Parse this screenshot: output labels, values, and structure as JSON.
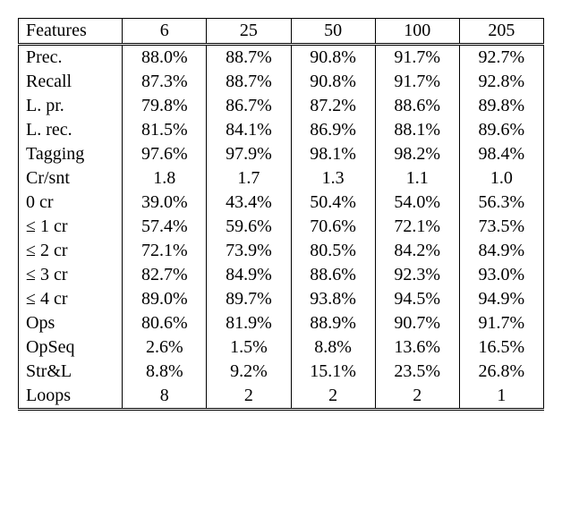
{
  "chart_data": {
    "type": "table",
    "title": "",
    "columns": [
      "Features",
      "6",
      "25",
      "50",
      "100",
      "205"
    ],
    "rows": [
      {
        "label": "Prec.",
        "values": [
          "88.0%",
          "88.7%",
          "90.8%",
          "91.7%",
          "92.7%"
        ]
      },
      {
        "label": "Recall",
        "values": [
          "87.3%",
          "88.7%",
          "90.8%",
          "91.7%",
          "92.8%"
        ]
      },
      {
        "label": "L. pr.",
        "values": [
          "79.8%",
          "86.7%",
          "87.2%",
          "88.6%",
          "89.8%"
        ]
      },
      {
        "label": "L. rec.",
        "values": [
          "81.5%",
          "84.1%",
          "86.9%",
          "88.1%",
          "89.6%"
        ]
      },
      {
        "label": "Tagging",
        "values": [
          "97.6%",
          "97.9%",
          "98.1%",
          "98.2%",
          "98.4%"
        ]
      },
      {
        "label": "Cr/snt",
        "values": [
          "1.8",
          "1.7",
          "1.3",
          "1.1",
          "1.0"
        ]
      },
      {
        "label": "0 cr",
        "values": [
          "39.0%",
          "43.4%",
          "50.4%",
          "54.0%",
          "56.3%"
        ]
      },
      {
        "label": "≤ 1 cr",
        "values": [
          "57.4%",
          "59.6%",
          "70.6%",
          "72.1%",
          "73.5%"
        ]
      },
      {
        "label": "≤ 2 cr",
        "values": [
          "72.1%",
          "73.9%",
          "80.5%",
          "84.2%",
          "84.9%"
        ]
      },
      {
        "label": "≤ 3 cr",
        "values": [
          "82.7%",
          "84.9%",
          "88.6%",
          "92.3%",
          "93.0%"
        ]
      },
      {
        "label": "≤ 4 cr",
        "values": [
          "89.0%",
          "89.7%",
          "93.8%",
          "94.5%",
          "94.9%"
        ]
      },
      {
        "label": "Ops",
        "values": [
          "80.6%",
          "81.9%",
          "88.9%",
          "90.7%",
          "91.7%"
        ]
      },
      {
        "label": "OpSeq",
        "values": [
          "2.6%",
          "1.5%",
          "8.8%",
          "13.6%",
          "16.5%"
        ]
      },
      {
        "label": "Str&L",
        "values": [
          "8.8%",
          "9.2%",
          "15.1%",
          "23.5%",
          "26.8%"
        ]
      },
      {
        "label": "Loops",
        "values": [
          "8",
          "2",
          "2",
          "2",
          "1"
        ]
      }
    ]
  }
}
